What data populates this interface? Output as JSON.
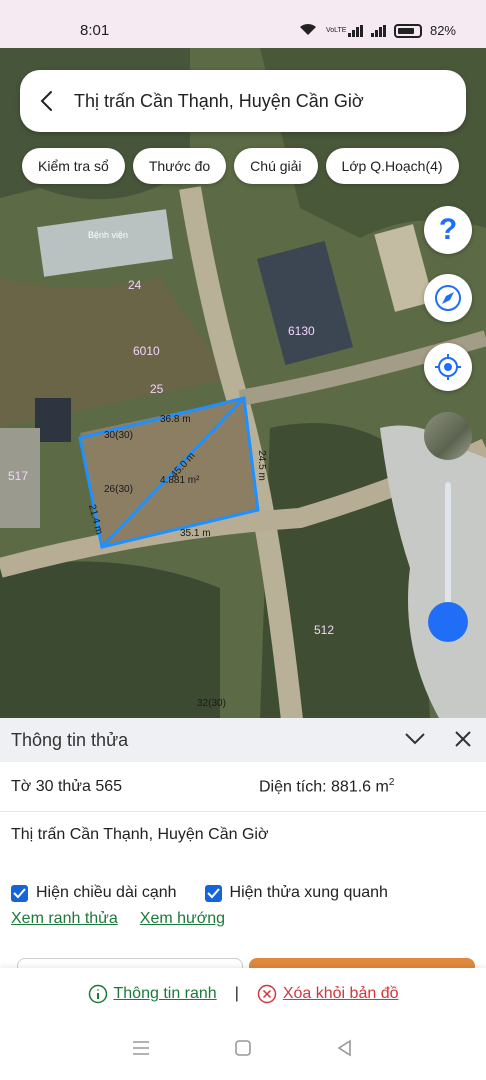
{
  "status": {
    "time": "8:01",
    "network": "VoLTE",
    "battery": "82%"
  },
  "search": {
    "title": "Thị trấn Cần Thạnh, Huyện Cần Giờ"
  },
  "chips": [
    {
      "label": "Kiểm tra sổ"
    },
    {
      "label": "Thước đo"
    },
    {
      "label": "Chú giải"
    },
    {
      "label": "Lớp Q.Hoạch(4)"
    }
  ],
  "map": {
    "parcel_labels": [
      "24",
      "6010",
      "25",
      "517",
      "6130",
      "512",
      "30(30)",
      "26(30)",
      "32(30)"
    ],
    "edges": {
      "top": "36.8 m",
      "right": "24.5 m",
      "bottom": "35.1 m",
      "left": "21.4 m",
      "diag": "45.0 m",
      "center": "4.881 m²"
    },
    "text_b": "Bệnh viện"
  },
  "sheet": {
    "title": "Thông tin thửa",
    "parcel": "Tờ 30 thửa 565",
    "area_label": "Diện tích: 881.6 m",
    "area_sup": "2",
    "address": "Thị trấn Cần Thạnh, Huyện Cần Giờ",
    "check1": "Hiện chiều dài cạnh",
    "check2": "Hiện thửa xung quanh",
    "link1": "Xem ranh thửa",
    "link2": "Xem hướng"
  },
  "footer": {
    "info_link": "Thông tin ranh",
    "separator": "|",
    "remove_link": "Xóa khỏi bản đồ"
  },
  "colors": {
    "accent": "#1f6ef5",
    "link_green": "#1b7a3a",
    "link_red": "#d3353a"
  }
}
